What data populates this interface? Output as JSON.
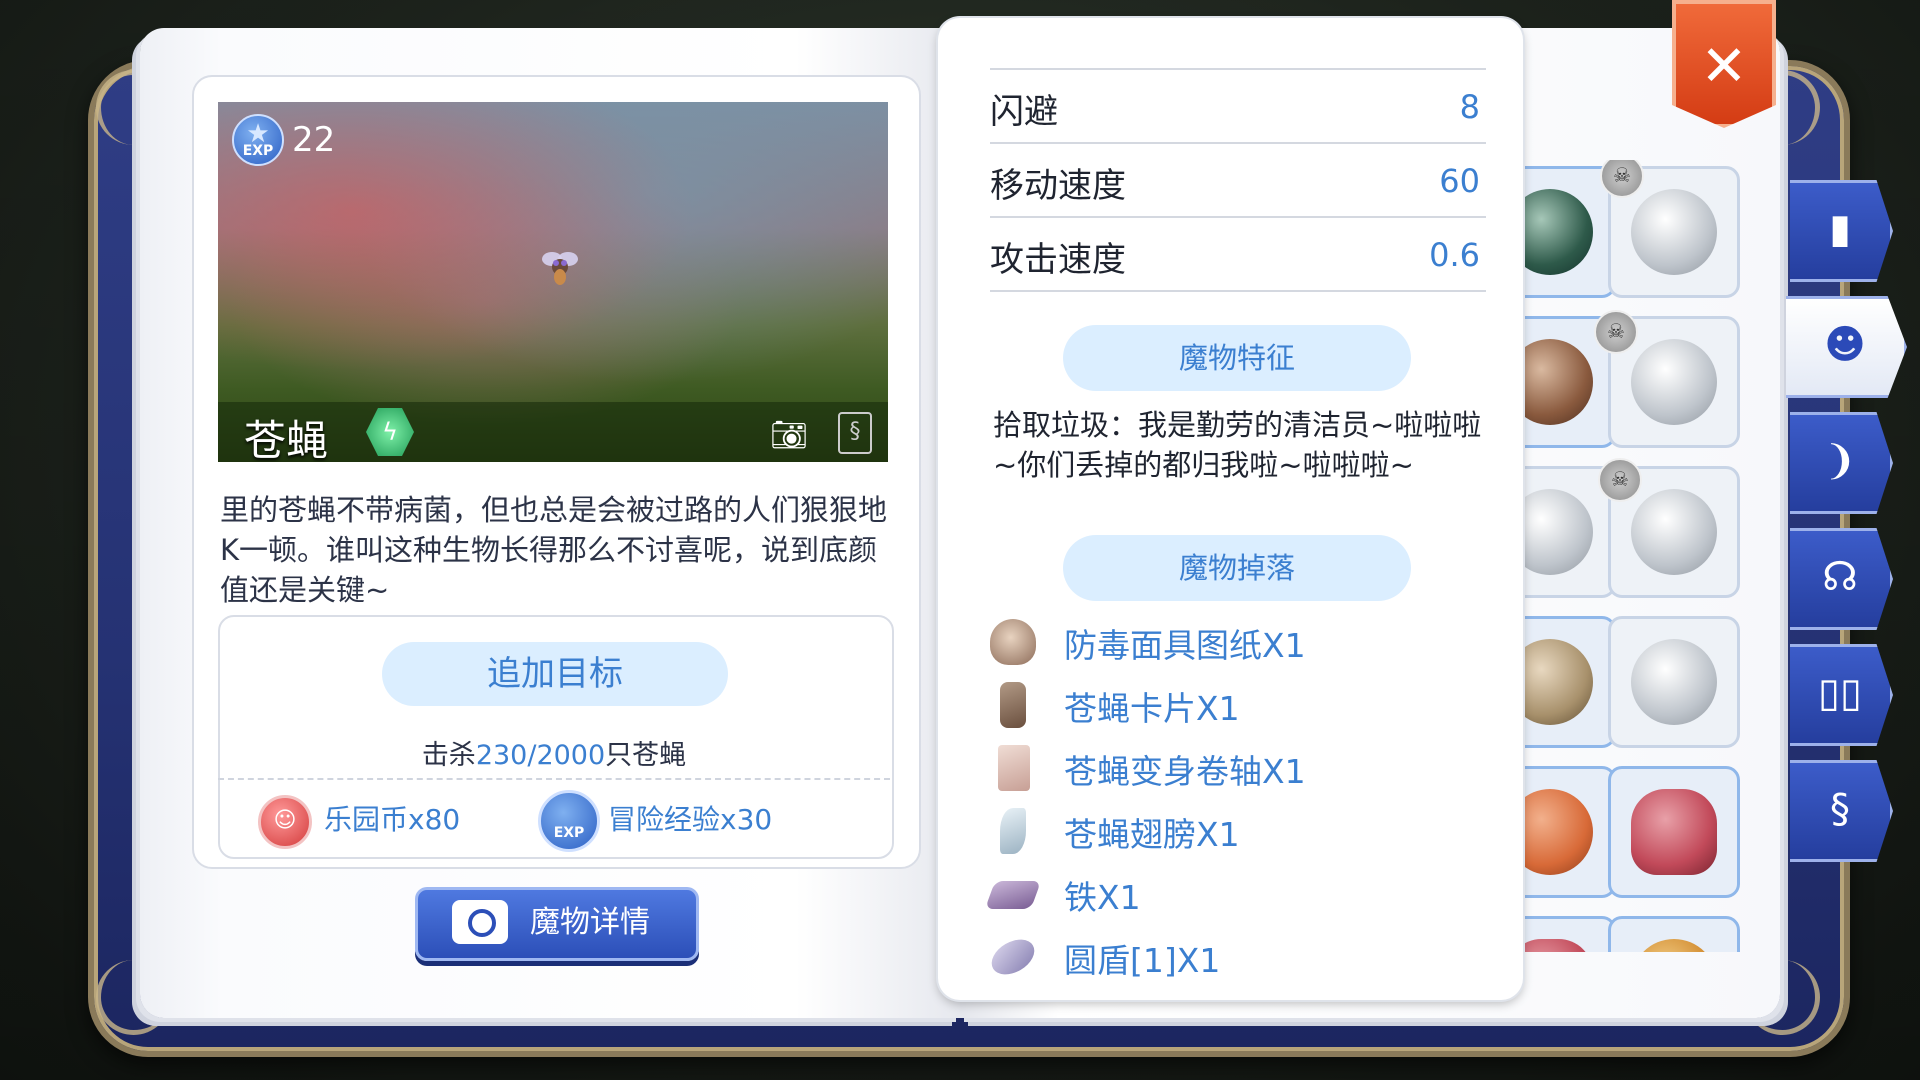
{
  "monster": {
    "name": "苍蝇",
    "exp_level": "22",
    "exp_badge": "EXP",
    "description": "里的苍蝇不带病菌，但也总是会被过路的人们狠狠地K一顿。谁叫这种生物长得那么不讨喜呢，说到底颜值还是关键~"
  },
  "target": {
    "add_button": "追加目标",
    "kill_prefix": "击杀",
    "kill_progress": "230/2000",
    "kill_suffix": "只苍蝇",
    "reward_coin": "乐园币x80",
    "reward_exp": "冒险经验x30",
    "reward_exp_badge": "EXP"
  },
  "detail_button": "魔物详情",
  "stats": [
    {
      "label": "闪避",
      "value": "8"
    },
    {
      "label": "移动速度",
      "value": "60"
    },
    {
      "label": "攻击速度",
      "value": "0.6"
    }
  ],
  "features": {
    "header": "魔物特征",
    "text": "拾取垃圾：我是勤劳的清洁员~啦啦啦~你们丢掉的都归我啦~啦啦啦~"
  },
  "drops": {
    "header": "魔物掉落",
    "items": [
      {
        "name": "防毒面具图纸X1",
        "icon": "gas-mask-blueprint-icon"
      },
      {
        "name": "苍蝇卡片X1",
        "icon": "card-icon"
      },
      {
        "name": "苍蝇变身卷轴X1",
        "icon": "scroll-icon"
      },
      {
        "name": "苍蝇翅膀X1",
        "icon": "wing-icon"
      },
      {
        "name": "铁X1",
        "icon": "iron-icon"
      },
      {
        "name": "圆盾[1]X1",
        "icon": "shield-icon"
      }
    ]
  },
  "side_tabs": [
    "book-icon",
    "monster-face-icon",
    "horn-icon",
    "head-icon",
    "open-book-icon",
    "card-icon"
  ],
  "colors": {
    "accent_blue": "#3b7fd0",
    "pill_bg": "#dbeeff",
    "cover": "#253273",
    "close_red": "#e4522a"
  }
}
